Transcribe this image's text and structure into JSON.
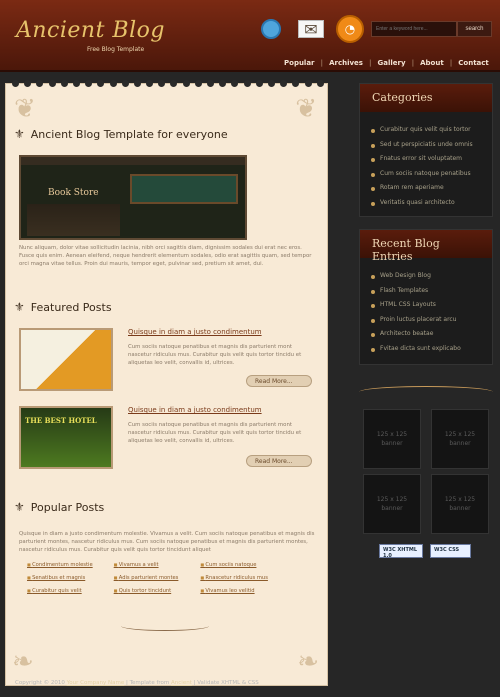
{
  "header": {
    "logo": "Ancient Blog",
    "tagline": "Free Blog Template",
    "search_placeholder": "Enter a keyword here...",
    "search_button": "search"
  },
  "nav": [
    "Popular",
    "Archives",
    "Gallery",
    "About",
    "Contact"
  ],
  "main": {
    "title": "Ancient Blog Template for everyone",
    "store_label": "Book Store",
    "intro": "Nunc aliquam, dolor vitae sollicitudin lacinia, nibh orci sagittis diam, dignissim sodales dui erat nec eros. Fusce quis enim. Aenean eleifend, neque hendrerit elementum sodales, odio erat sagittis quam, sed tempor orci magna vitae tellus. Proin dui mauris, tempor eget, pulvinar sed, pretium sit amet, dui.",
    "featured_title": "Featured Posts",
    "posts": [
      {
        "title": "Quisque in diam a justo condimentum",
        "text": "Cum sociis natoque penatibus et magnis dis parturient mont nascetur ridiculus mus. Curabitur quis velit quis tortor tincidu et aliquetas leo velit, convallis id, ultrices.",
        "readmore": "Read More..."
      },
      {
        "title": "Quisque in diam a justo condimentum",
        "text": "Cum sociis natoque penatibus et magnis dis parturient mont nascetur ridiculus mus. Curabitur quis velit quis tortor tincidu et aliquetas leo velit, convallis id, ultrices.",
        "readmore": "Read More..."
      }
    ],
    "thumb2_text": "THE BEST HOTEL",
    "popular_title": "Popular Posts",
    "popular_text": "Quisque in diam a justo condimentum molestie. Vivamus a velit. Cum sociis natoque penatibus et magnis dis parturient montes, nascetur ridiculus mus. Cum sociis natoque penatibus et magnis dis parturient montes, nascetur ridiculus mus. Curabitur quis velit quis tortor tincidunt aliquet",
    "popular_links": [
      [
        "Condimentum molestie",
        "Senatibus et magnis",
        "Curabitur quis velit"
      ],
      [
        "Vivamus a velit",
        "Adis parturient montes",
        "Quis tortor tincidunt"
      ],
      [
        "Cum sociis natoque",
        "Rnascetur ridiculus mus",
        "Vivamus leo velitid"
      ]
    ]
  },
  "sidebar": {
    "categories_title": "Categories",
    "categories": [
      "Curabitur quis velit quis tortor",
      "Sed ut perspiciatis unde omnis",
      "Fnatus error sit voluptatem",
      "Cum sociis natoque penatibus",
      "Rotam rem aperiame",
      "Veritatis quasi architecto"
    ],
    "recent_title": "Recent Blog Entries",
    "recent": [
      "Web Design Blog",
      "Flash Templates",
      "HTML CSS Layouts",
      "Proin luctus placerat arcu",
      "Architecto beatae",
      "Fvitae dicta sunt explicabo"
    ],
    "banner_size": "125 x 125",
    "banner_label": "banner",
    "valid_xhtml": "W3C XHTML 1.0",
    "valid_css": "W3C CSS"
  },
  "footer": {
    "prefix": "Copyright © 2010 ",
    "company": "Your Company Name",
    "mid": " | Template from ",
    "template": "Ancient",
    "suffix": " | Validate XHTML & CSS"
  }
}
